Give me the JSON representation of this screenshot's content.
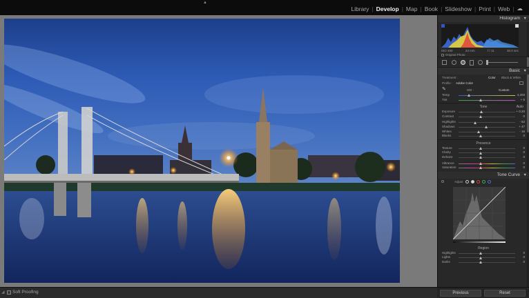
{
  "modules": [
    "Library",
    "Develop",
    "Map",
    "Book",
    "Slideshow",
    "Print",
    "Web"
  ],
  "active_module": "Develop",
  "toolbar": {
    "soft_proofing_label": "Soft Proofing"
  },
  "histogram": {
    "title": "Histogram",
    "info": [
      "ISO 200",
      "24 mm",
      "f / 11",
      "30.0 sec"
    ],
    "original_photo_label": "Original Photo"
  },
  "basic": {
    "title": "Basic",
    "treatment_label": "Treatment :",
    "color_label": "Color",
    "bw_label": "Black & White",
    "profile_label": "Profile :",
    "profile_value": "Adobe Color",
    "wb_label": "WB :",
    "wb_value": "Custom",
    "temp_label": "Temp",
    "temp_value": "4,203",
    "tint_label": "Tint",
    "tint_value": "+ 5",
    "tone_label": "Tone",
    "auto_label": "Auto",
    "exposure_label": "Exposure",
    "exposure_value": "+ 0.20",
    "contrast_label": "Contrast",
    "contrast_value": "0",
    "highlights_label": "Highlights",
    "highlights_value": "- 52",
    "shadows_label": "Shadows",
    "shadows_value": "+ 47",
    "whites_label": "Whites",
    "whites_value": "- 16",
    "blacks_label": "Blacks",
    "blacks_value": "0",
    "presence_label": "Presence",
    "texture_label": "Texture",
    "texture_value": "0",
    "clarity_label": "Clarity",
    "clarity_value": "0",
    "dehaze_label": "Dehaze",
    "dehaze_value": "0",
    "vibrance_label": "Vibrance",
    "vibrance_value": "0",
    "saturation_label": "Saturation",
    "saturation_value": "0"
  },
  "tone_curve": {
    "title": "Tone Curve",
    "adjust_label": "Adjust",
    "region_label": "Region",
    "highlights_label": "Highlights",
    "highlights_value": "0",
    "lights_label": "Lights",
    "lights_value": "0",
    "darks_label": "Darks",
    "darks_value": "0"
  },
  "buttons": {
    "previous": "Previous",
    "reset": "Reset"
  },
  "colors": {
    "panel_bg": "#282828",
    "workspace_bg": "#7a7a7a",
    "active_text": "#f2f2f2"
  }
}
